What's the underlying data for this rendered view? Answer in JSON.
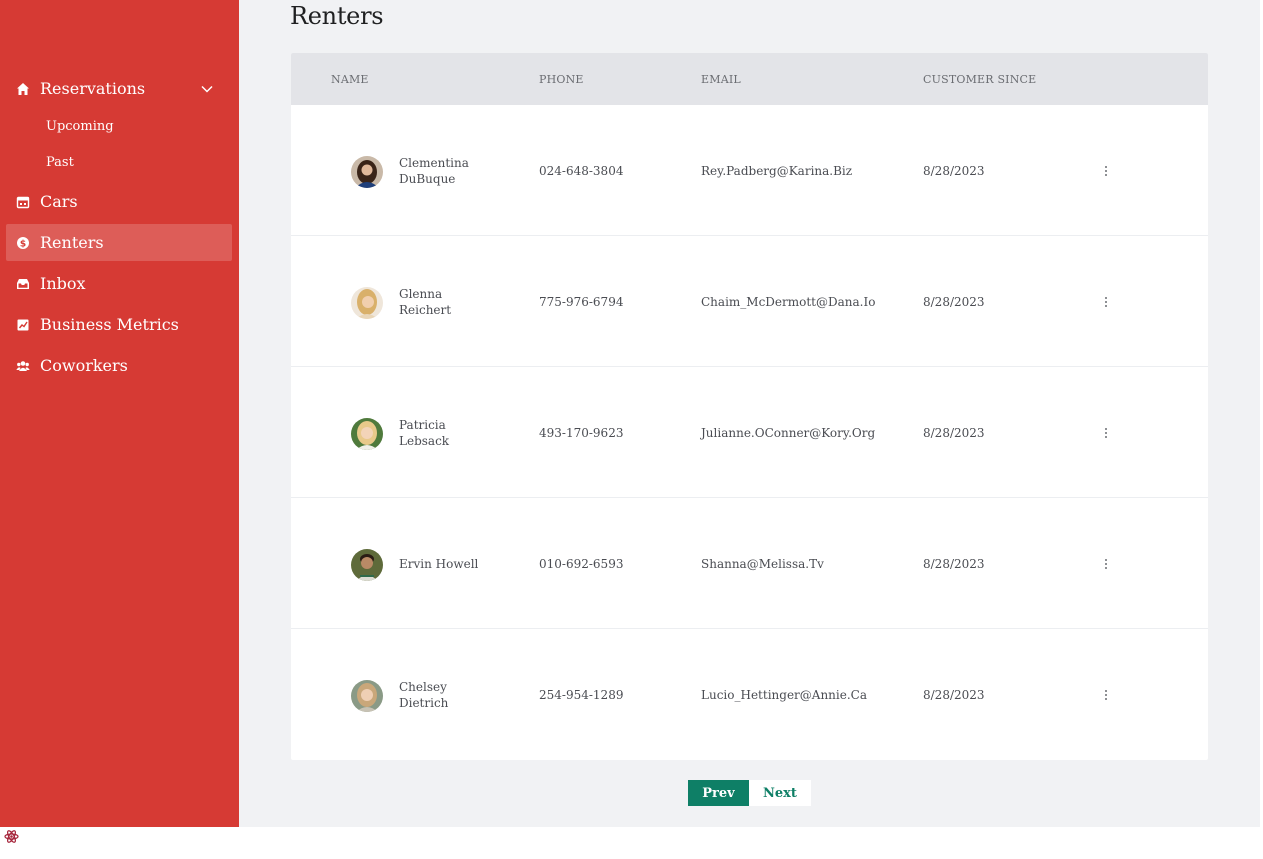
{
  "sidebar": {
    "items": [
      {
        "label": "Reservations",
        "icon": "home-icon"
      },
      {
        "label": "Cars",
        "icon": "calendar-icon"
      },
      {
        "label": "Renters",
        "icon": "dollar-coin-icon"
      },
      {
        "label": "Inbox",
        "icon": "inbox-icon"
      },
      {
        "label": "Business Metrics",
        "icon": "chart-icon"
      },
      {
        "label": "Coworkers",
        "icon": "users-icon"
      }
    ],
    "subitems": [
      {
        "label": "Upcoming"
      },
      {
        "label": "Past"
      }
    ],
    "active": "Renters"
  },
  "page": {
    "title": "Renters"
  },
  "table": {
    "headers": {
      "name": "NAME",
      "phone": "PHONE",
      "email": "EMAIL",
      "since": "CUSTOMER SINCE"
    },
    "rows": [
      {
        "first": "Clementina",
        "last": "DuBuque",
        "phone": "024-648-3804",
        "email": "Rey.Padberg@Karina.Biz",
        "since": "8/28/2023"
      },
      {
        "first": "Glenna",
        "last": "Reichert",
        "phone": "775-976-6794",
        "email": "Chaim_McDermott@Dana.Io",
        "since": "8/28/2023"
      },
      {
        "first": "Patricia",
        "last": "Lebsack",
        "phone": "493-170-9623",
        "email": "Julianne.OConner@Kory.Org",
        "since": "8/28/2023"
      },
      {
        "first": "Ervin Howell",
        "last": "",
        "phone": "010-692-6593",
        "email": "Shanna@Melissa.Tv",
        "since": "8/28/2023"
      },
      {
        "first": "Chelsey",
        "last": "Dietrich",
        "phone": "254-954-1289",
        "email": "Lucio_Hettinger@Annie.Ca",
        "since": "8/28/2023"
      }
    ]
  },
  "pager": {
    "prev": "Prev",
    "next": "Next"
  },
  "colors": {
    "sidebar": "#d63a34",
    "accent": "#0e7f66",
    "background": "#f1f2f4"
  }
}
